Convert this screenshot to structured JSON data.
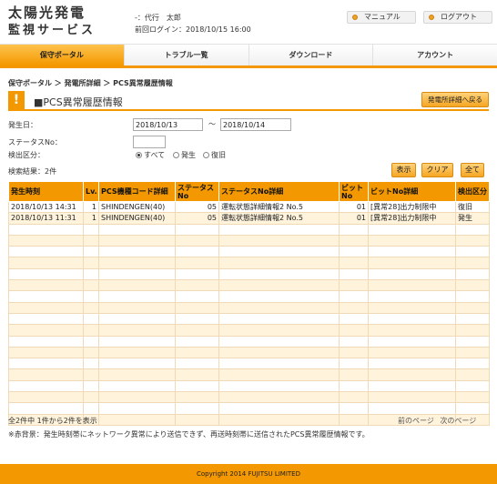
{
  "header": {
    "logo_line1": "太陽光発電",
    "logo_line2": "監視サービス",
    "user": "-：代行　太郎",
    "last_login": "前回ログイン：2018/10/15 16:00",
    "manual_label": "マニュアル",
    "logout_label": "ログアウト",
    "accent": "#f39800"
  },
  "nav": {
    "items": [
      "保守ポータル",
      "トラブル一覧",
      "ダウンロード",
      "アカウント"
    ],
    "active": 0
  },
  "breadcrumb": "保守ポータル ＞ 発電所詳細 ＞ PCS異常履歴情報",
  "page": {
    "title": "■PCS異常履歴情報",
    "back_label": "発電所詳細へ戻る"
  },
  "form": {
    "date_label": "発生日：",
    "date_from": "2018/10/13",
    "date_sep": "〜",
    "date_to": "2018/10/14",
    "status_label": "ステータスNo：",
    "status_value": "",
    "detect_label": "検出区分：",
    "radio_all": "すべて",
    "radio_occur": "発生",
    "radio_recover": "復旧",
    "result_label": "検索結果：2件",
    "btn_show": "表示",
    "btn_clear": "クリア",
    "btn_all": "全て"
  },
  "table": {
    "headers": [
      "発生時刻",
      "Lv.",
      "PCS機種コード詳細",
      "ステータスNo",
      "ステータスNo詳細",
      "ビットNo",
      "ビットNo詳細",
      "検出区分"
    ],
    "rows": [
      [
        "2018/10/13 14:31",
        "1",
        "SHINDENGEN(40)",
        "05",
        "運転状態詳細情報2 No.5",
        "01",
        "[異常28]出力制限中",
        "復旧"
      ],
      [
        "2018/10/13 11:31",
        "1",
        "SHINDENGEN(40)",
        "05",
        "運転状態詳細情報2 No.5",
        "01",
        "[異常28]出力制限中",
        "発生"
      ]
    ]
  },
  "pager": {
    "summary": "全2件中 1件から2件を表示",
    "prev": "前のページ",
    "next": "次のページ"
  },
  "note": "※赤背景：発生時刻帯にネットワーク異常により送信できず、再送時刻帯に送信されたPCS異常履歴情報です。",
  "footer": "Copyright 2014 FUJITSU LIMITED"
}
